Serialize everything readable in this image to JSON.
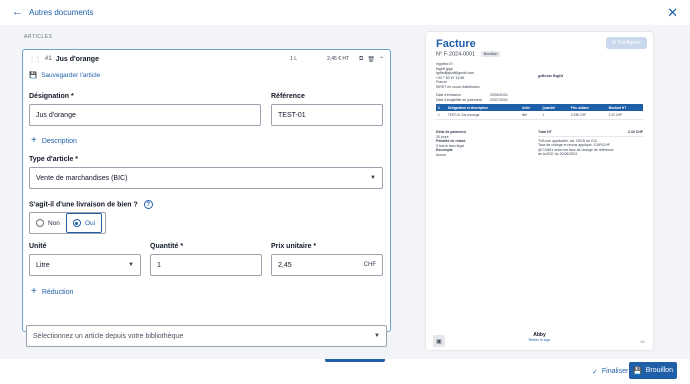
{
  "header": {
    "back_label": "Autres documents",
    "back_icon": "arrow-left-icon",
    "close_icon": "close-icon"
  },
  "articles": {
    "section_label": "ARTICLES",
    "item": {
      "index": "#1",
      "name": "Jus d'orange",
      "qty_short": "1 L",
      "price_short": "2,45 € HT",
      "save_label": "Sauvegarder l'article",
      "designation_label": "Désignation *",
      "designation_value": "Jus d'orange",
      "reference_label": "Référence",
      "reference_value": "TEST-01",
      "description_label": "Description",
      "type_label": "Type d'article *",
      "type_value": "Vente de marchandises (BIC)",
      "livraison_question": "S'agit-il d'une livraison de bien ?",
      "radio_no": "Non",
      "radio_yes": "Oui",
      "radio_selected": "Oui",
      "unite_label": "Unité",
      "unite_value": "Litre",
      "quantite_label": "Quantité *",
      "quantite_value": "1",
      "prix_label": "Prix unitaire *",
      "prix_value": "2,45",
      "prix_currency": "CHF",
      "reduction_label": "Réduction"
    },
    "library_placeholder": "Sélectionnez un article depuis votre bibliothèque"
  },
  "preview": {
    "title": "Facture",
    "number": "N° F-2024-0001",
    "badge": "Brouillon",
    "config_label": "Configurer",
    "sender": [
      "Ingrdfkx El",
      "fdgfdf gdgf",
      "fgdfsdfjdjsdf@gmail.com",
      "+33 7 83 67 16 58",
      "France",
      "SIRET en cours d'attribution"
    ],
    "client": "gdfcsw fbgfd",
    "date_emission_label": "Date d'émission",
    "date_emission": "20/06/2024",
    "date_exigibilite_label": "Date d'exigibilité du paiement",
    "date_exigibilite": "20/07/2024",
    "table_headers": [
      "#",
      "Désignation et description",
      "Unité",
      "Quantité",
      "Prix unitaire",
      "Montant HT"
    ],
    "table_rows": [
      [
        "1",
        "TEST-01 Jus d'orange",
        "litre",
        "1",
        "2.33€ CHF",
        "2.33 CHF"
      ]
    ],
    "delai_label": "Délai de paiement",
    "delai_value": "30 jours",
    "penalite_label": "Pénalité de retard",
    "penalite_value": "3 fois le taux légal",
    "escompte_label": "Escompte",
    "escompte_value": "Aucun",
    "total_label": "Total HT",
    "total_value": "2.33 CHF",
    "tva_note": "TVA non applicable, art. 293 B du CGI",
    "rate_note": "Taux de change en euros appliqué : EUR/CHF",
    "rate_note2": "@ 0,9461 selon les taux de change de référence",
    "rate_note3": "de la BCE du 20/06/2024",
    "brand": "Abby",
    "brand_sub": "Retirer le logo",
    "page_num": "1/1"
  },
  "footer": {
    "finalize_label": "Finaliser",
    "draft_label": "Brouillon"
  }
}
